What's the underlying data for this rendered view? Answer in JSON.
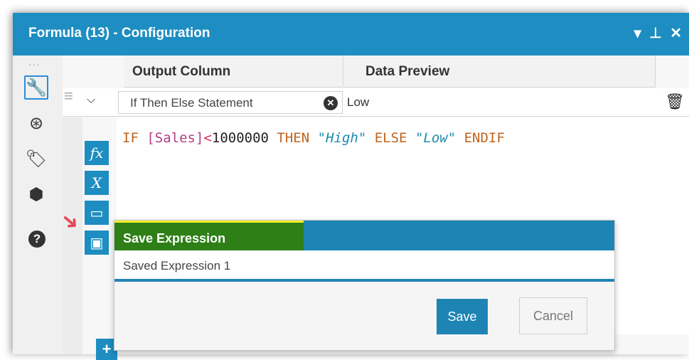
{
  "window": {
    "title": "Formula (13) - Configuration",
    "controls": [
      "▾",
      "⊥",
      "✕"
    ]
  },
  "sidebar": {
    "icons": [
      "wrench-icon",
      "navigate-icon",
      "tag-icon",
      "box-icon",
      "help-icon"
    ],
    "help_glyph": "?"
  },
  "grid": {
    "headers": {
      "output_column": "Output Column",
      "data_preview": "Data Preview"
    },
    "row": {
      "output_name": "If Then Else Statement",
      "preview_value": "Low"
    }
  },
  "tools": {
    "function_label": "fx",
    "variable_label": "X"
  },
  "expression": {
    "if_kw": "IF",
    "field": "[Sales]",
    "operator": "<",
    "number": "1000000",
    "then_kw": "THEN",
    "then_str": "\"High\"",
    "else_kw": "ELSE",
    "else_str": "\"Low\"",
    "endif_kw": "ENDIF"
  },
  "save_dialog": {
    "title": "Save Expression",
    "name_value": "Saved Expression 1",
    "save_label": "Save",
    "cancel_label": "Cancel"
  },
  "add_button": "+",
  "colors": {
    "accent": "#1e8dc1",
    "highlight": "#2d7f16",
    "arrow": "#e8495b"
  }
}
